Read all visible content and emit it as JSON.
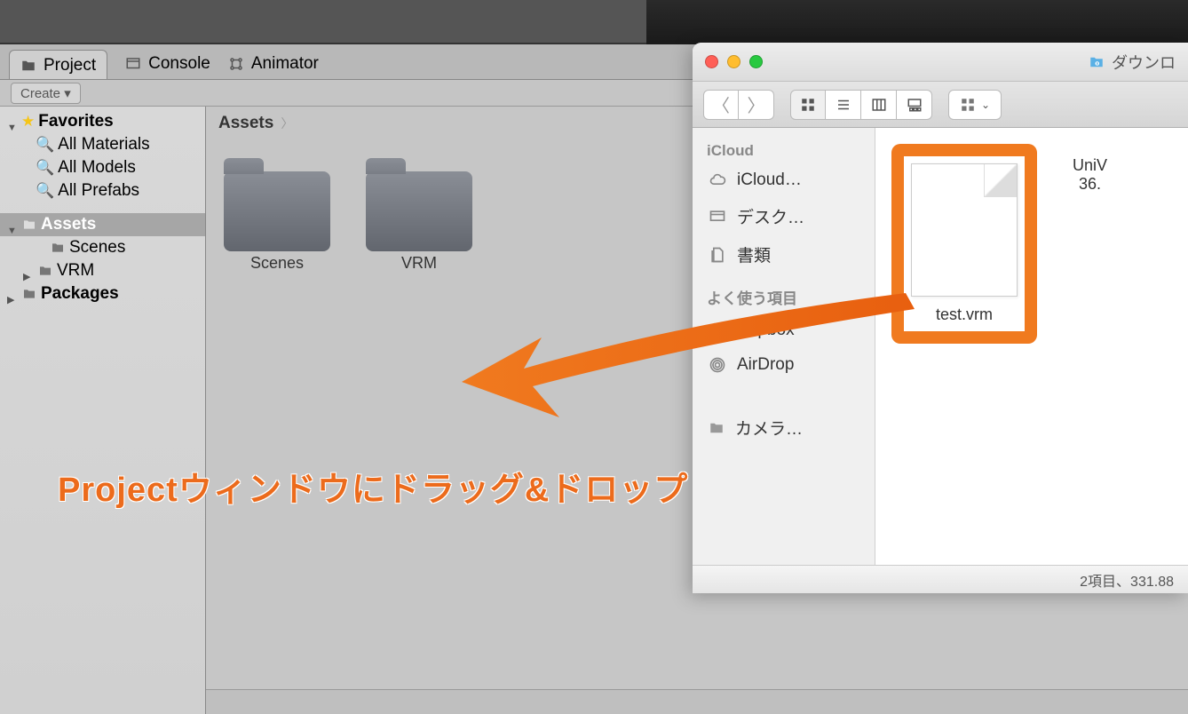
{
  "topbar": {},
  "tabs": {
    "project": "Project",
    "console": "Console",
    "animator": "Animator"
  },
  "toolbar": {
    "create": "Create ▾"
  },
  "tree": {
    "favorites": "Favorites",
    "fav_items": [
      "All Materials",
      "All Models",
      "All Prefabs"
    ],
    "assets": "Assets",
    "assets_children": [
      "Scenes",
      "VRM"
    ],
    "packages": "Packages"
  },
  "breadcrumb": {
    "root": "Assets"
  },
  "folders": [
    {
      "label": "Scenes"
    },
    {
      "label": "VRM"
    }
  ],
  "finder": {
    "title": "ダウンロ",
    "sidebar": {
      "section_icloud": "iCloud",
      "icloud": "iCloud…",
      "desktop": "デスク…",
      "documents": "書類",
      "section_fav": "よく使う項目",
      "dropbox": "Dropbox",
      "airdrop": "AirDrop",
      "camera": "カメラ…"
    },
    "files": [
      {
        "label": "test.vrm",
        "highlighted": true
      },
      {
        "label": "UniV",
        "label2": "36."
      }
    ],
    "status": "2項目、331.88"
  },
  "annotation": "Projectウィンドウにドラッグ&ドロップ"
}
